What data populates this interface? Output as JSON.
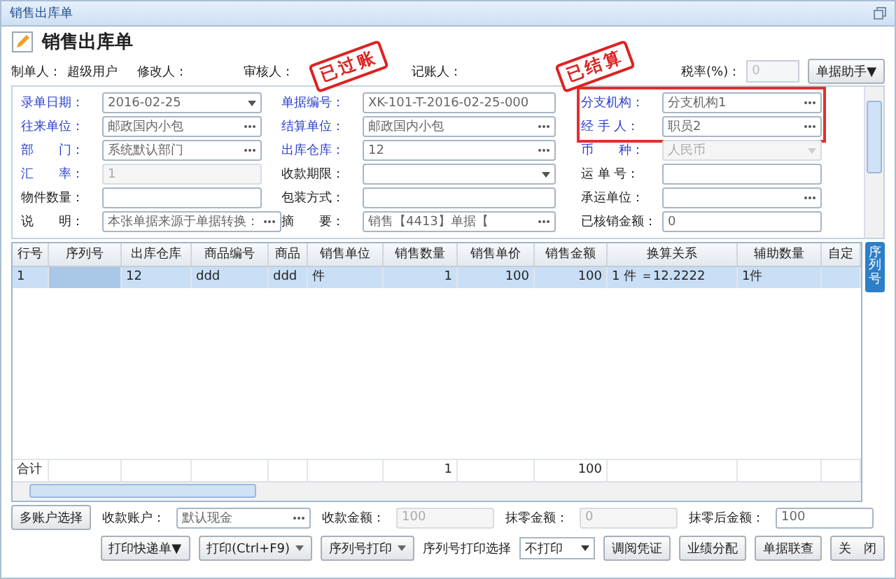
{
  "window": {
    "title": "销售出库单"
  },
  "header": {
    "title": "销售出库单"
  },
  "info": [
    {
      "label": "制单人：",
      "value": "超级用户"
    },
    {
      "label": "修改人："
    },
    {
      "label": "审核人："
    },
    {
      "label": "记账人："
    }
  ],
  "stamps": [
    "已过账",
    "已结算"
  ],
  "tax": {
    "label": "税率(%)：",
    "value": "0"
  },
  "helper_button": "单据助手▼",
  "form_columns": [
    [
      {
        "label": "录单日期：",
        "value": "2016-02-25",
        "kind": "date",
        "required": true,
        "disabled": false,
        "highlighted": false
      },
      {
        "label": "往来单位：",
        "value": "邮政国内小包",
        "kind": "lookup",
        "required": true,
        "disabled": false,
        "highlighted": false
      },
      {
        "label": "部　　门：",
        "value": "系统默认部门",
        "kind": "lookup",
        "required": true,
        "disabled": false,
        "highlighted": false
      },
      {
        "label": "汇　　率：",
        "value": "1",
        "kind": "text",
        "required": true,
        "disabled": true,
        "highlighted": false
      },
      {
        "label": "物件数量：",
        "kind": "text",
        "required": false,
        "disabled": false,
        "highlighted": false
      },
      {
        "label": "说　　明：",
        "value": "本张单据来源于单据转换：",
        "kind": "lookup",
        "required": false,
        "disabled": false,
        "highlighted": false
      }
    ],
    [
      {
        "label": "单据编号：",
        "value": "XK-101-T-2016-02-25-000",
        "kind": "text",
        "required": true,
        "disabled": false,
        "highlighted": false
      },
      {
        "label": "结算单位：",
        "value": "邮政国内小包",
        "kind": "lookup",
        "required": true,
        "disabled": false,
        "highlighted": false
      },
      {
        "label": "出库仓库：",
        "value": "12",
        "kind": "lookup",
        "required": true,
        "disabled": false,
        "highlighted": false
      },
      {
        "label": "收款期限：",
        "kind": "dropdown",
        "required": false,
        "disabled": false,
        "highlighted": false
      },
      {
        "label": "包装方式：",
        "kind": "text",
        "required": false,
        "disabled": false,
        "highlighted": false
      },
      {
        "label": "摘　　要：",
        "value": "销售【4413】单据【",
        "kind": "lookup",
        "required": false,
        "disabled": false,
        "highlighted": false
      }
    ],
    [
      {
        "label": "分支机构：",
        "value": "分支机构1",
        "kind": "lookup",
        "required": true,
        "disabled": false,
        "highlighted": true
      },
      {
        "label": "经 手 人：",
        "value": "职员2",
        "kind": "lookup",
        "required": true,
        "disabled": false,
        "highlighted": true
      },
      {
        "label": "币　　种：",
        "value": "人民币",
        "kind": "dropdown",
        "required": true,
        "disabled": true,
        "highlighted": false
      },
      {
        "label": "运 单 号：",
        "kind": "text",
        "required": false,
        "disabled": false,
        "highlighted": false
      },
      {
        "label": "承运单位：",
        "kind": "lookup",
        "required": false,
        "disabled": false,
        "highlighted": false
      },
      {
        "label": "已核销金额：",
        "value": "0",
        "kind": "text",
        "required": false,
        "disabled": false,
        "highlighted": false
      }
    ]
  ],
  "table": {
    "columns": [
      "行号",
      "序列号",
      "出库仓库",
      "商品编号",
      "商品",
      "销售单位",
      "销售数量",
      "销售单价",
      "销售金额",
      "换算关系",
      "辅助数量",
      "自定"
    ],
    "rows": [
      {
        "selected": true,
        "cells": [
          "1",
          null,
          "12",
          "ddd",
          "ddd",
          "件",
          "1",
          "100",
          "100",
          "1 件 ＝12.2222",
          "1件",
          null
        ]
      }
    ],
    "total": {
      "label": "合计",
      "cells": [
        null,
        null,
        null,
        null,
        null,
        "1",
        null,
        "100",
        null,
        null,
        null
      ]
    }
  },
  "side_tab": "序列号",
  "payment": {
    "multi_button": "多账户选择",
    "fields": [
      {
        "label": "收款账户：",
        "value": "默认现金",
        "kind": "lookup",
        "disabled": false
      },
      {
        "label": "收款金额：",
        "value": "100",
        "kind": "text",
        "disabled": true
      },
      {
        "label": "抹零金额：",
        "value": "0",
        "kind": "text",
        "disabled": true
      },
      {
        "label": "抹零后金额：",
        "value": "100",
        "kind": "text",
        "disabled": false
      }
    ]
  },
  "actions": [
    {
      "label": "打印快递单▼",
      "kind": "button"
    },
    {
      "label": "打印(Ctrl+F9)",
      "kind": "split"
    },
    {
      "label": "序列号打印",
      "kind": "split"
    },
    {
      "label": "序列号打印选择",
      "kind": "label"
    },
    {
      "label": "不打印",
      "kind": "select"
    },
    {
      "label": "调阅凭证",
      "kind": "button"
    },
    {
      "label": "业绩分配",
      "kind": "button"
    },
    {
      "label": "单据联查",
      "kind": "button"
    },
    {
      "label": "关　闭",
      "kind": "button"
    }
  ]
}
